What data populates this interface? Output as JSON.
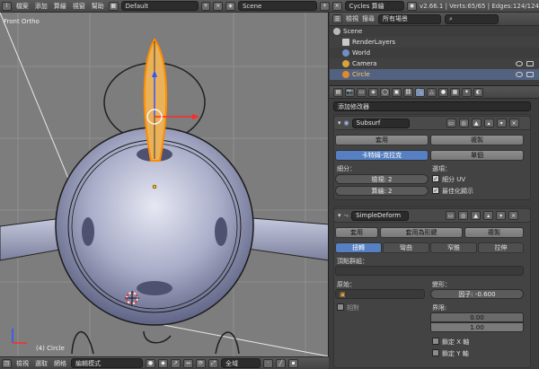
{
  "topbar": {
    "menus": [
      "檔案",
      "添加",
      "算繪",
      "視窗",
      "幫助"
    ],
    "layout": "Default",
    "scene": "Scene",
    "engine": "Cycles 算繪",
    "stats": "v2.66.1 | Verts:65/65 | Edges:124/124"
  },
  "viewport": {
    "view_label": "Front Ortho",
    "object_label": "(4) Circle",
    "header_menus": [
      "檢視",
      "選取",
      "網格"
    ],
    "mode": "編輯模式",
    "pivot": "全域"
  },
  "outliner": {
    "view_menu": "檢視",
    "search_menu": "搜尋",
    "filter": "所有場景",
    "rows": [
      {
        "name": "Scene",
        "color": "#b8b8b8"
      },
      {
        "name": "RenderLayers",
        "color": "#c9c9c9"
      },
      {
        "name": "World",
        "color": "#6f8fc7"
      },
      {
        "name": "Camera",
        "color": "#d9a23a"
      },
      {
        "name": "Circle",
        "color": "#e08a28"
      }
    ]
  },
  "properties": {
    "add_modifier": "添加修改器",
    "subsurf": {
      "name": "Subsurf",
      "apply": "套用",
      "copy": "複製",
      "type_catmull": "卡特姆-克拉克",
      "type_simple": "單個",
      "subdiv_label": "細分：",
      "view_field": "檢視: 2",
      "render_field": "算繪: 2",
      "options_label": "選項：",
      "subdiv_uv": "細分 UV",
      "optimal_display": "最佳化顯示"
    },
    "simpledeform": {
      "name": "SimpleDeform",
      "apply": "套用",
      "apply_shape": "套用為形鍵",
      "copy": "複製",
      "modes": [
        "扭轉",
        "彎曲",
        "窄錐",
        "拉伸"
      ],
      "vgroup_label": "頂點群組：",
      "origin_label": "原始：",
      "relative": "相對",
      "deform_label": "變形：",
      "factor": "因子: -0.600",
      "limits_label": "界限:",
      "limit_min": "0.00",
      "limit_max": "1.00",
      "lock_x": "鎖定 X 軸",
      "lock_y": "鎖定 Y 軸"
    }
  }
}
